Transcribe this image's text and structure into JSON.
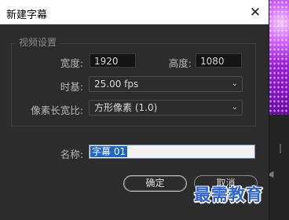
{
  "dialog": {
    "title": "新建字幕",
    "close_glyph": "✕",
    "video_settings": {
      "legend": "视频设置",
      "width_label": "宽度:",
      "width_value": "1920",
      "height_label": "高度:",
      "height_value": "1080",
      "timebase_label": "时基:",
      "timebase_value": "25.00 fps",
      "pixel_aspect_label": "像素长宽比:",
      "pixel_aspect_value": "方形像素 (1.0)"
    },
    "name_label": "名称:",
    "name_value": "字幕 01",
    "ok_label": "确定",
    "cancel_label": "取消"
  },
  "watermark": "最需教育",
  "icons": {
    "close": "close-icon",
    "dropdown": "chevron-down-icon",
    "speaker": "speaker-icon"
  },
  "colors": {
    "dialog_bg": "#2c2c2c",
    "titlebar_bg": "#ffffff",
    "selection": "#1e64c8",
    "watermark": "#2e63d6",
    "thumb_purple": "#9b1fd8"
  }
}
